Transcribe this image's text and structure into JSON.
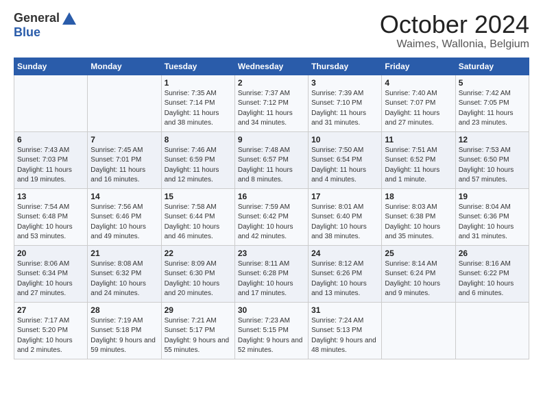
{
  "logo": {
    "general": "General",
    "blue": "Blue"
  },
  "header": {
    "title": "October 2024",
    "subtitle": "Waimes, Wallonia, Belgium"
  },
  "weekdays": [
    "Sunday",
    "Monday",
    "Tuesday",
    "Wednesday",
    "Thursday",
    "Friday",
    "Saturday"
  ],
  "weeks": [
    [
      {
        "day": "",
        "sunrise": "",
        "sunset": "",
        "daylight": ""
      },
      {
        "day": "",
        "sunrise": "",
        "sunset": "",
        "daylight": ""
      },
      {
        "day": "1",
        "sunrise": "Sunrise: 7:35 AM",
        "sunset": "Sunset: 7:14 PM",
        "daylight": "Daylight: 11 hours and 38 minutes."
      },
      {
        "day": "2",
        "sunrise": "Sunrise: 7:37 AM",
        "sunset": "Sunset: 7:12 PM",
        "daylight": "Daylight: 11 hours and 34 minutes."
      },
      {
        "day": "3",
        "sunrise": "Sunrise: 7:39 AM",
        "sunset": "Sunset: 7:10 PM",
        "daylight": "Daylight: 11 hours and 31 minutes."
      },
      {
        "day": "4",
        "sunrise": "Sunrise: 7:40 AM",
        "sunset": "Sunset: 7:07 PM",
        "daylight": "Daylight: 11 hours and 27 minutes."
      },
      {
        "day": "5",
        "sunrise": "Sunrise: 7:42 AM",
        "sunset": "Sunset: 7:05 PM",
        "daylight": "Daylight: 11 hours and 23 minutes."
      }
    ],
    [
      {
        "day": "6",
        "sunrise": "Sunrise: 7:43 AM",
        "sunset": "Sunset: 7:03 PM",
        "daylight": "Daylight: 11 hours and 19 minutes."
      },
      {
        "day": "7",
        "sunrise": "Sunrise: 7:45 AM",
        "sunset": "Sunset: 7:01 PM",
        "daylight": "Daylight: 11 hours and 16 minutes."
      },
      {
        "day": "8",
        "sunrise": "Sunrise: 7:46 AM",
        "sunset": "Sunset: 6:59 PM",
        "daylight": "Daylight: 11 hours and 12 minutes."
      },
      {
        "day": "9",
        "sunrise": "Sunrise: 7:48 AM",
        "sunset": "Sunset: 6:57 PM",
        "daylight": "Daylight: 11 hours and 8 minutes."
      },
      {
        "day": "10",
        "sunrise": "Sunrise: 7:50 AM",
        "sunset": "Sunset: 6:54 PM",
        "daylight": "Daylight: 11 hours and 4 minutes."
      },
      {
        "day": "11",
        "sunrise": "Sunrise: 7:51 AM",
        "sunset": "Sunset: 6:52 PM",
        "daylight": "Daylight: 11 hours and 1 minute."
      },
      {
        "day": "12",
        "sunrise": "Sunrise: 7:53 AM",
        "sunset": "Sunset: 6:50 PM",
        "daylight": "Daylight: 10 hours and 57 minutes."
      }
    ],
    [
      {
        "day": "13",
        "sunrise": "Sunrise: 7:54 AM",
        "sunset": "Sunset: 6:48 PM",
        "daylight": "Daylight: 10 hours and 53 minutes."
      },
      {
        "day": "14",
        "sunrise": "Sunrise: 7:56 AM",
        "sunset": "Sunset: 6:46 PM",
        "daylight": "Daylight: 10 hours and 49 minutes."
      },
      {
        "day": "15",
        "sunrise": "Sunrise: 7:58 AM",
        "sunset": "Sunset: 6:44 PM",
        "daylight": "Daylight: 10 hours and 46 minutes."
      },
      {
        "day": "16",
        "sunrise": "Sunrise: 7:59 AM",
        "sunset": "Sunset: 6:42 PM",
        "daylight": "Daylight: 10 hours and 42 minutes."
      },
      {
        "day": "17",
        "sunrise": "Sunrise: 8:01 AM",
        "sunset": "Sunset: 6:40 PM",
        "daylight": "Daylight: 10 hours and 38 minutes."
      },
      {
        "day": "18",
        "sunrise": "Sunrise: 8:03 AM",
        "sunset": "Sunset: 6:38 PM",
        "daylight": "Daylight: 10 hours and 35 minutes."
      },
      {
        "day": "19",
        "sunrise": "Sunrise: 8:04 AM",
        "sunset": "Sunset: 6:36 PM",
        "daylight": "Daylight: 10 hours and 31 minutes."
      }
    ],
    [
      {
        "day": "20",
        "sunrise": "Sunrise: 8:06 AM",
        "sunset": "Sunset: 6:34 PM",
        "daylight": "Daylight: 10 hours and 27 minutes."
      },
      {
        "day": "21",
        "sunrise": "Sunrise: 8:08 AM",
        "sunset": "Sunset: 6:32 PM",
        "daylight": "Daylight: 10 hours and 24 minutes."
      },
      {
        "day": "22",
        "sunrise": "Sunrise: 8:09 AM",
        "sunset": "Sunset: 6:30 PM",
        "daylight": "Daylight: 10 hours and 20 minutes."
      },
      {
        "day": "23",
        "sunrise": "Sunrise: 8:11 AM",
        "sunset": "Sunset: 6:28 PM",
        "daylight": "Daylight: 10 hours and 17 minutes."
      },
      {
        "day": "24",
        "sunrise": "Sunrise: 8:12 AM",
        "sunset": "Sunset: 6:26 PM",
        "daylight": "Daylight: 10 hours and 13 minutes."
      },
      {
        "day": "25",
        "sunrise": "Sunrise: 8:14 AM",
        "sunset": "Sunset: 6:24 PM",
        "daylight": "Daylight: 10 hours and 9 minutes."
      },
      {
        "day": "26",
        "sunrise": "Sunrise: 8:16 AM",
        "sunset": "Sunset: 6:22 PM",
        "daylight": "Daylight: 10 hours and 6 minutes."
      }
    ],
    [
      {
        "day": "27",
        "sunrise": "Sunrise: 7:17 AM",
        "sunset": "Sunset: 5:20 PM",
        "daylight": "Daylight: 10 hours and 2 minutes."
      },
      {
        "day": "28",
        "sunrise": "Sunrise: 7:19 AM",
        "sunset": "Sunset: 5:18 PM",
        "daylight": "Daylight: 9 hours and 59 minutes."
      },
      {
        "day": "29",
        "sunrise": "Sunrise: 7:21 AM",
        "sunset": "Sunset: 5:17 PM",
        "daylight": "Daylight: 9 hours and 55 minutes."
      },
      {
        "day": "30",
        "sunrise": "Sunrise: 7:23 AM",
        "sunset": "Sunset: 5:15 PM",
        "daylight": "Daylight: 9 hours and 52 minutes."
      },
      {
        "day": "31",
        "sunrise": "Sunrise: 7:24 AM",
        "sunset": "Sunset: 5:13 PM",
        "daylight": "Daylight: 9 hours and 48 minutes."
      },
      {
        "day": "",
        "sunrise": "",
        "sunset": "",
        "daylight": ""
      },
      {
        "day": "",
        "sunrise": "",
        "sunset": "",
        "daylight": ""
      }
    ]
  ]
}
